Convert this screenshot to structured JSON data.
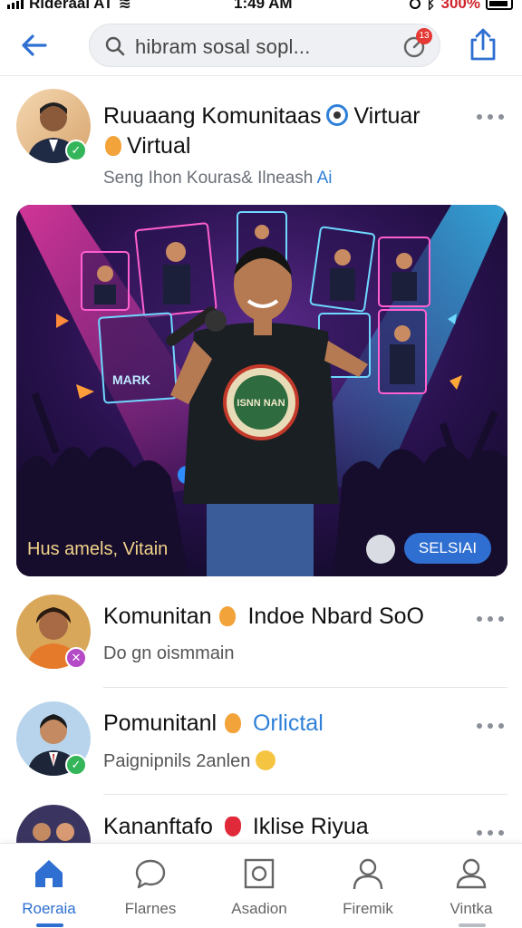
{
  "status_bar": {
    "carrier": "Rlderaal AT",
    "time": "1:49 AM",
    "battery": "300%"
  },
  "top_bar": {
    "search_text": "hibram sosal sopl...",
    "notification_count": "13"
  },
  "featured_post": {
    "title_part1": "Ruuaang Komunitaas",
    "title_part2": "Virtuar",
    "title_part3": "Virtual",
    "subtitle": "Seng Ihon Kouras& Ilneash",
    "subtitle_highlight": "Ai",
    "image_caption": "Hus amels, Vitain",
    "image_button": "SELSIAI",
    "shirt_text": "ISNN NAN"
  },
  "communities": [
    {
      "title": "Komunitan",
      "title_rest": "Indoe Nbard SoO",
      "accent": "",
      "subtitle": "Do gn oismmain",
      "badge": "✕"
    },
    {
      "title": "Pomunitanl",
      "title_rest": "",
      "accent": "Orlictal",
      "subtitle": "Paignipnils 2anlen",
      "badge": "✓"
    },
    {
      "title": "Kananftafo",
      "title_rest": "Iklise Riyua",
      "accent": "",
      "subtitle": "",
      "badge": ""
    }
  ],
  "bottom_nav": [
    {
      "label": "Roeraia",
      "icon": "home-icon",
      "active": true
    },
    {
      "label": "Flarnes",
      "icon": "chat-bubble-icon",
      "active": false
    },
    {
      "label": "Asadion",
      "icon": "square-icon",
      "active": false
    },
    {
      "label": "Firemik",
      "icon": "person-icon",
      "active": false
    },
    {
      "label": "Vintka",
      "icon": "profile-icon",
      "active": false
    }
  ],
  "colors": {
    "accent": "#2f6fd1",
    "link": "#2f80d8",
    "verified": "#34b55a"
  }
}
